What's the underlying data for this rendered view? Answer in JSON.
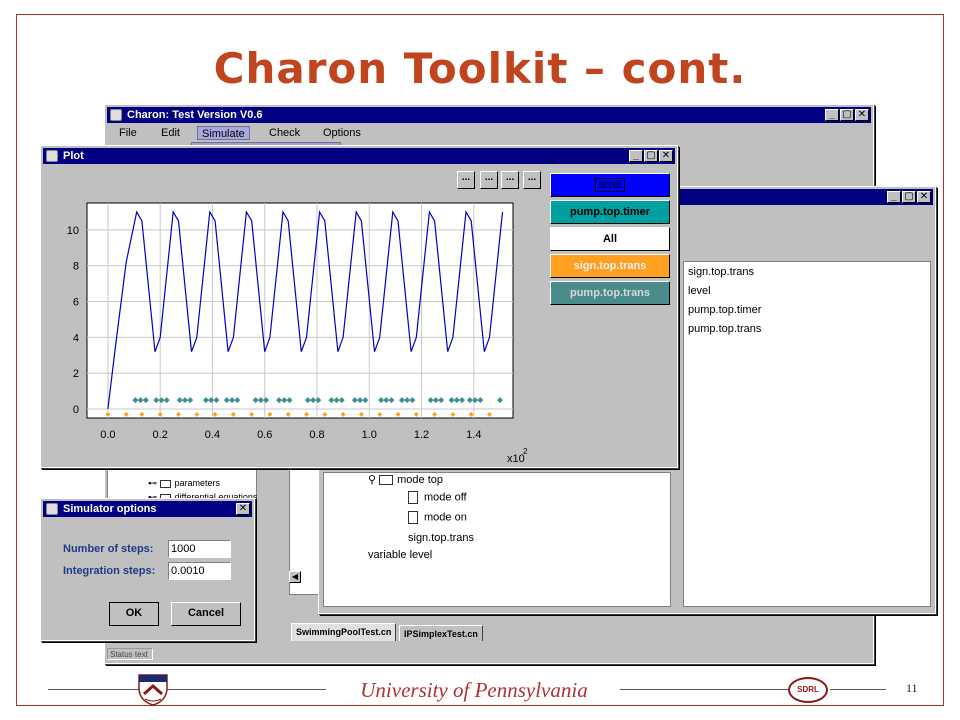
{
  "slide": {
    "title": "Charon Toolkit – cont.",
    "university": "University of Pennsylvania",
    "page_number": "11",
    "lab_logo_text": "SDRL"
  },
  "main_window": {
    "title": "Charon: Test Version V0.6",
    "menu": [
      "File",
      "Edit",
      "Simulate",
      "Check",
      "Options"
    ],
    "active_menu": "Simulate",
    "status_text": "Status text",
    "tree": [
      "parameters",
      "differential equations"
    ],
    "tabs": [
      "SwimmingPoolTest.cn",
      "IPSimplexTest.cn"
    ]
  },
  "variable_window": {
    "modes": [
      "mode top",
      "mode off",
      "mode on",
      "sign.top.trans",
      "variable level"
    ],
    "variables": [
      "sign.top.trans",
      "level",
      "pump.top.timer",
      "pump.top.trans"
    ]
  },
  "plot_window": {
    "title": "Plot",
    "small_buttons": [
      "...",
      "...",
      "...",
      "..."
    ],
    "series_buttons": [
      {
        "label": "level",
        "bg": "#0000ff",
        "fg": "#000000"
      },
      {
        "label": "pump.top.timer",
        "bg": "#00a0a0",
        "fg": "#000000"
      },
      {
        "label": "All",
        "bg": "#ffffff",
        "fg": "#000000"
      },
      {
        "label": "sign.top.trans",
        "bg": "#ffa020",
        "fg": "#f0f0f0"
      },
      {
        "label": "pump.top.trans",
        "bg": "#4a8c8c",
        "fg": "#d8d8d8"
      }
    ]
  },
  "chart_data": {
    "type": "line",
    "xlabel": "x10",
    "xlabel_exponent": "2",
    "xlim": [
      -0.08,
      1.55
    ],
    "ylim": [
      -0.5,
      11.5
    ],
    "x_ticks": [
      0.0,
      0.2,
      0.4,
      0.6,
      0.8,
      1.0,
      1.2,
      1.4
    ],
    "y_ticks": [
      0,
      2,
      4,
      6,
      8,
      10
    ],
    "grid": true,
    "series": [
      {
        "name": "level",
        "color": "#0000c8",
        "style": "line",
        "points": [
          [
            0.0,
            0
          ],
          [
            0.03,
            3.6
          ],
          [
            0.07,
            8.2
          ],
          [
            0.11,
            11.0
          ],
          [
            0.13,
            10.5
          ],
          [
            0.18,
            3.2
          ],
          [
            0.2,
            4.0
          ],
          [
            0.25,
            11.0
          ],
          [
            0.27,
            10.5
          ],
          [
            0.32,
            3.2
          ],
          [
            0.34,
            4.0
          ],
          [
            0.39,
            11.0
          ],
          [
            0.41,
            10.5
          ],
          [
            0.46,
            3.2
          ],
          [
            0.48,
            4.0
          ],
          [
            0.53,
            11.0
          ],
          [
            0.55,
            10.5
          ],
          [
            0.6,
            3.2
          ],
          [
            0.62,
            4.0
          ],
          [
            0.67,
            11.0
          ],
          [
            0.69,
            10.5
          ],
          [
            0.74,
            3.2
          ],
          [
            0.76,
            4.0
          ],
          [
            0.81,
            11.0
          ],
          [
            0.83,
            10.5
          ],
          [
            0.88,
            3.2
          ],
          [
            0.9,
            4.0
          ],
          [
            0.95,
            11.0
          ],
          [
            0.97,
            10.5
          ],
          [
            1.02,
            3.2
          ],
          [
            1.04,
            4.0
          ],
          [
            1.09,
            11.0
          ],
          [
            1.11,
            10.5
          ],
          [
            1.16,
            3.2
          ],
          [
            1.18,
            4.0
          ],
          [
            1.23,
            11.0
          ],
          [
            1.25,
            10.5
          ],
          [
            1.3,
            3.2
          ],
          [
            1.32,
            4.0
          ],
          [
            1.37,
            11.0
          ],
          [
            1.39,
            10.5
          ],
          [
            1.44,
            3.2
          ],
          [
            1.46,
            4.0
          ],
          [
            1.51,
            11.0
          ]
        ]
      },
      {
        "name": "pump.top.trans",
        "color": "#3f8f8f",
        "style": "markers",
        "points": [
          [
            0.105,
            0.5
          ],
          [
            0.125,
            0.5
          ],
          [
            0.145,
            0.5
          ],
          [
            0.185,
            0.5
          ],
          [
            0.205,
            0.5
          ],
          [
            0.225,
            0.5
          ],
          [
            0.275,
            0.5
          ],
          [
            0.295,
            0.5
          ],
          [
            0.315,
            0.5
          ],
          [
            0.375,
            0.5
          ],
          [
            0.395,
            0.5
          ],
          [
            0.415,
            0.5
          ],
          [
            0.455,
            0.5
          ],
          [
            0.475,
            0.5
          ],
          [
            0.495,
            0.5
          ],
          [
            0.565,
            0.5
          ],
          [
            0.585,
            0.5
          ],
          [
            0.605,
            0.5
          ],
          [
            0.655,
            0.5
          ],
          [
            0.675,
            0.5
          ],
          [
            0.695,
            0.5
          ],
          [
            0.765,
            0.5
          ],
          [
            0.785,
            0.5
          ],
          [
            0.805,
            0.5
          ],
          [
            0.855,
            0.5
          ],
          [
            0.875,
            0.5
          ],
          [
            0.895,
            0.5
          ],
          [
            0.945,
            0.5
          ],
          [
            0.965,
            0.5
          ],
          [
            0.985,
            0.5
          ],
          [
            1.045,
            0.5
          ],
          [
            1.065,
            0.5
          ],
          [
            1.085,
            0.5
          ],
          [
            1.125,
            0.5
          ],
          [
            1.145,
            0.5
          ],
          [
            1.165,
            0.5
          ],
          [
            1.235,
            0.5
          ],
          [
            1.255,
            0.5
          ],
          [
            1.275,
            0.5
          ],
          [
            1.315,
            0.5
          ],
          [
            1.335,
            0.5
          ],
          [
            1.355,
            0.5
          ],
          [
            1.385,
            0.5
          ],
          [
            1.405,
            0.5
          ],
          [
            1.425,
            0.5
          ],
          [
            1.5,
            0.5
          ]
        ]
      },
      {
        "name": "sign.top.trans",
        "color": "#ffa020",
        "style": "markers",
        "points": [
          [
            0.0,
            -0.3
          ],
          [
            0.07,
            -0.3
          ],
          [
            0.13,
            -0.3
          ],
          [
            0.2,
            -0.3
          ],
          [
            0.27,
            -0.3
          ],
          [
            0.34,
            -0.3
          ],
          [
            0.41,
            -0.3
          ],
          [
            0.48,
            -0.3
          ],
          [
            0.55,
            -0.3
          ],
          [
            0.62,
            -0.3
          ],
          [
            0.69,
            -0.3
          ],
          [
            0.76,
            -0.3
          ],
          [
            0.83,
            -0.3
          ],
          [
            0.9,
            -0.3
          ],
          [
            0.97,
            -0.3
          ],
          [
            1.04,
            -0.3
          ],
          [
            1.11,
            -0.3
          ],
          [
            1.18,
            -0.3
          ],
          [
            1.25,
            -0.3
          ],
          [
            1.32,
            -0.3
          ],
          [
            1.39,
            -0.3
          ],
          [
            1.46,
            -0.3
          ]
        ]
      }
    ]
  },
  "simulator_options": {
    "title": "Simulator options",
    "steps_label": "Number of steps:",
    "steps_value": "1000",
    "integration_label": "Integration steps:",
    "integration_value": "0.0010",
    "ok_label": "OK",
    "cancel_label": "Cancel"
  }
}
